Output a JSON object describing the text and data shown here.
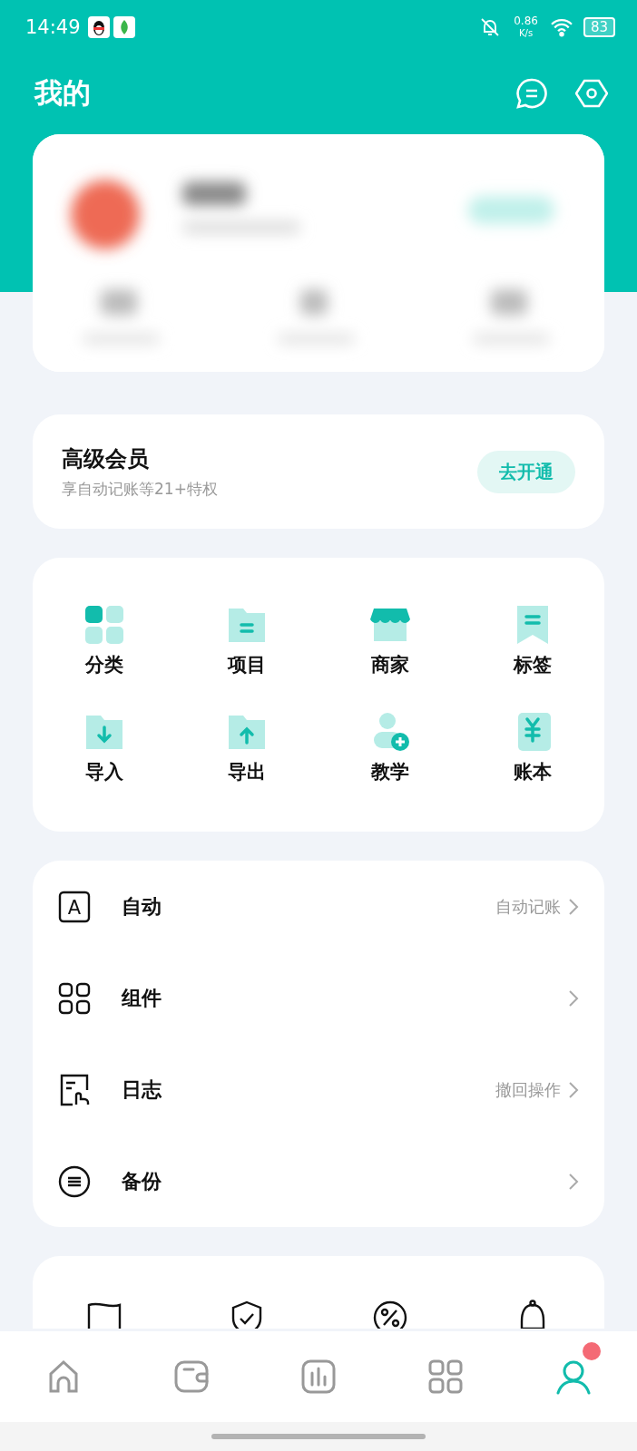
{
  "status_bar": {
    "time": "14:49",
    "speed": "0.86",
    "speed_unit": "K/s",
    "battery": "83"
  },
  "header": {
    "title": "我的"
  },
  "vip": {
    "title": "高级会员",
    "subtitle": "享自动记账等21+特权",
    "button": "去开通"
  },
  "grid": [
    {
      "label": "分类",
      "kind": "category"
    },
    {
      "label": "项目",
      "kind": "folder"
    },
    {
      "label": "商家",
      "kind": "shop"
    },
    {
      "label": "标签",
      "kind": "tag"
    },
    {
      "label": "导入",
      "kind": "import"
    },
    {
      "label": "导出",
      "kind": "export"
    },
    {
      "label": "教学",
      "kind": "user-add"
    },
    {
      "label": "账本",
      "kind": "ledger"
    }
  ],
  "list": [
    {
      "label": "自动",
      "value": "自动记账",
      "kind": "auto",
      "icon_text": "A"
    },
    {
      "label": "组件",
      "kind": "widgets"
    },
    {
      "label": "日志",
      "value": "撤回操作",
      "kind": "log"
    },
    {
      "label": "备份",
      "kind": "backup"
    }
  ],
  "more_icons": [
    {
      "kind": "flag"
    },
    {
      "kind": "shield"
    },
    {
      "kind": "percent"
    },
    {
      "kind": "bell"
    }
  ],
  "nav": [
    {
      "kind": "home",
      "selected": false,
      "notification": false
    },
    {
      "kind": "wallet",
      "selected": false,
      "notification": false
    },
    {
      "kind": "chart",
      "selected": false,
      "notification": false
    },
    {
      "kind": "apps",
      "selected": false,
      "notification": false
    },
    {
      "kind": "profile",
      "selected": true,
      "notification": true
    }
  ]
}
